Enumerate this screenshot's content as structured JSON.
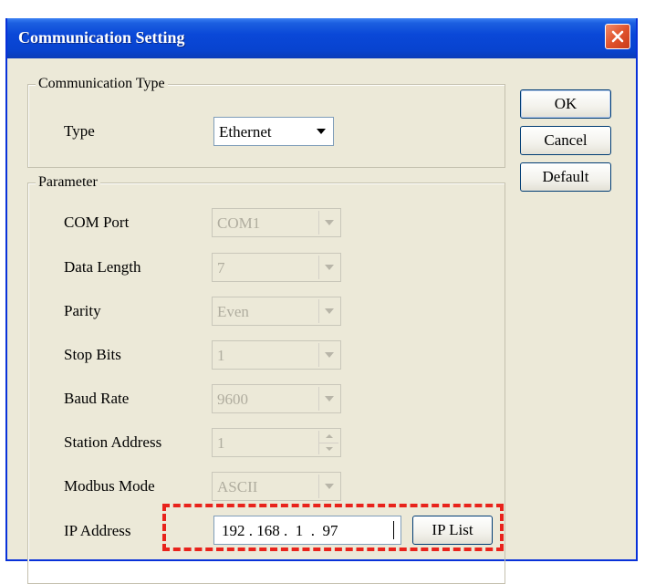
{
  "window": {
    "title": "Communication Setting"
  },
  "communication_type": {
    "legend": "Communication Type",
    "type_label": "Type",
    "type_value": "Ethernet"
  },
  "parameter": {
    "legend": "Parameter",
    "com_port": {
      "label": "COM Port",
      "value": "COM1"
    },
    "data_length": {
      "label": "Data Length",
      "value": "7"
    },
    "parity": {
      "label": "Parity",
      "value": "Even"
    },
    "stop_bits": {
      "label": "Stop Bits",
      "value": "1"
    },
    "baud_rate": {
      "label": "Baud Rate",
      "value": "9600"
    },
    "station_address": {
      "label": "Station Address",
      "value": "1"
    },
    "modbus_mode": {
      "label": "Modbus Mode",
      "value": "ASCII"
    },
    "ip_address": {
      "label": "IP Address",
      "value": "192 . 168 .  1  .  97"
    }
  },
  "buttons": {
    "ok": "OK",
    "cancel": "Cancel",
    "default": "Default",
    "ip_list": "IP List"
  },
  "colors": {
    "titlebar": "#0a48d8",
    "highlight_dash": "#e8231c",
    "dialog_bg": "#ece9d8"
  },
  "icons": {
    "close": "close-icon",
    "dropdown": "chevron-down-icon",
    "spinner": "spinner-icon"
  }
}
